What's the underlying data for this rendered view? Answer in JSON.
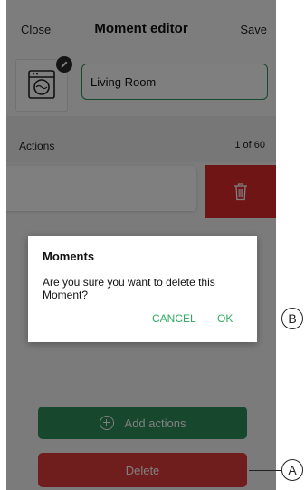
{
  "header": {
    "close_label": "Close",
    "title": "Moment editor",
    "save_label": "Save"
  },
  "moment": {
    "name_value": "Living Room",
    "icon": "washing-machine-icon",
    "edit_icon": "pencil-icon"
  },
  "actions": {
    "label": "Actions",
    "count": "1 of 60",
    "delete_icon": "trash-icon"
  },
  "buttons": {
    "add_actions_label": "Add actions",
    "delete_label": "Delete"
  },
  "dialog": {
    "title": "Moments",
    "message": "Are you sure you want to delete this Moment?",
    "cancel_label": "CANCEL",
    "ok_label": "OK"
  },
  "callouts": {
    "a": "A",
    "b": "B"
  },
  "colors": {
    "green": "#2f8f58",
    "link_green": "#2eab62",
    "red": "#e02b2b"
  }
}
